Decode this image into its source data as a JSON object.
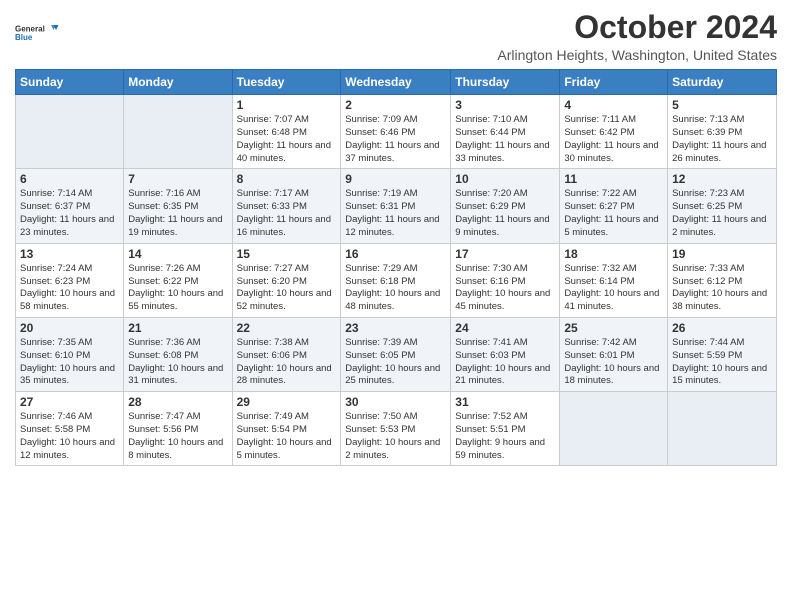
{
  "header": {
    "logo_general": "General",
    "logo_blue": "Blue",
    "month_title": "October 2024",
    "location": "Arlington Heights, Washington, United States"
  },
  "columns": [
    "Sunday",
    "Monday",
    "Tuesday",
    "Wednesday",
    "Thursday",
    "Friday",
    "Saturday"
  ],
  "weeks": [
    [
      {
        "day": "",
        "sunrise": "",
        "sunset": "",
        "daylight": ""
      },
      {
        "day": "",
        "sunrise": "",
        "sunset": "",
        "daylight": ""
      },
      {
        "day": "1",
        "sunrise": "Sunrise: 7:07 AM",
        "sunset": "Sunset: 6:48 PM",
        "daylight": "Daylight: 11 hours and 40 minutes."
      },
      {
        "day": "2",
        "sunrise": "Sunrise: 7:09 AM",
        "sunset": "Sunset: 6:46 PM",
        "daylight": "Daylight: 11 hours and 37 minutes."
      },
      {
        "day": "3",
        "sunrise": "Sunrise: 7:10 AM",
        "sunset": "Sunset: 6:44 PM",
        "daylight": "Daylight: 11 hours and 33 minutes."
      },
      {
        "day": "4",
        "sunrise": "Sunrise: 7:11 AM",
        "sunset": "Sunset: 6:42 PM",
        "daylight": "Daylight: 11 hours and 30 minutes."
      },
      {
        "day": "5",
        "sunrise": "Sunrise: 7:13 AM",
        "sunset": "Sunset: 6:39 PM",
        "daylight": "Daylight: 11 hours and 26 minutes."
      }
    ],
    [
      {
        "day": "6",
        "sunrise": "Sunrise: 7:14 AM",
        "sunset": "Sunset: 6:37 PM",
        "daylight": "Daylight: 11 hours and 23 minutes."
      },
      {
        "day": "7",
        "sunrise": "Sunrise: 7:16 AM",
        "sunset": "Sunset: 6:35 PM",
        "daylight": "Daylight: 11 hours and 19 minutes."
      },
      {
        "day": "8",
        "sunrise": "Sunrise: 7:17 AM",
        "sunset": "Sunset: 6:33 PM",
        "daylight": "Daylight: 11 hours and 16 minutes."
      },
      {
        "day": "9",
        "sunrise": "Sunrise: 7:19 AM",
        "sunset": "Sunset: 6:31 PM",
        "daylight": "Daylight: 11 hours and 12 minutes."
      },
      {
        "day": "10",
        "sunrise": "Sunrise: 7:20 AM",
        "sunset": "Sunset: 6:29 PM",
        "daylight": "Daylight: 11 hours and 9 minutes."
      },
      {
        "day": "11",
        "sunrise": "Sunrise: 7:22 AM",
        "sunset": "Sunset: 6:27 PM",
        "daylight": "Daylight: 11 hours and 5 minutes."
      },
      {
        "day": "12",
        "sunrise": "Sunrise: 7:23 AM",
        "sunset": "Sunset: 6:25 PM",
        "daylight": "Daylight: 11 hours and 2 minutes."
      }
    ],
    [
      {
        "day": "13",
        "sunrise": "Sunrise: 7:24 AM",
        "sunset": "Sunset: 6:23 PM",
        "daylight": "Daylight: 10 hours and 58 minutes."
      },
      {
        "day": "14",
        "sunrise": "Sunrise: 7:26 AM",
        "sunset": "Sunset: 6:22 PM",
        "daylight": "Daylight: 10 hours and 55 minutes."
      },
      {
        "day": "15",
        "sunrise": "Sunrise: 7:27 AM",
        "sunset": "Sunset: 6:20 PM",
        "daylight": "Daylight: 10 hours and 52 minutes."
      },
      {
        "day": "16",
        "sunrise": "Sunrise: 7:29 AM",
        "sunset": "Sunset: 6:18 PM",
        "daylight": "Daylight: 10 hours and 48 minutes."
      },
      {
        "day": "17",
        "sunrise": "Sunrise: 7:30 AM",
        "sunset": "Sunset: 6:16 PM",
        "daylight": "Daylight: 10 hours and 45 minutes."
      },
      {
        "day": "18",
        "sunrise": "Sunrise: 7:32 AM",
        "sunset": "Sunset: 6:14 PM",
        "daylight": "Daylight: 10 hours and 41 minutes."
      },
      {
        "day": "19",
        "sunrise": "Sunrise: 7:33 AM",
        "sunset": "Sunset: 6:12 PM",
        "daylight": "Daylight: 10 hours and 38 minutes."
      }
    ],
    [
      {
        "day": "20",
        "sunrise": "Sunrise: 7:35 AM",
        "sunset": "Sunset: 6:10 PM",
        "daylight": "Daylight: 10 hours and 35 minutes."
      },
      {
        "day": "21",
        "sunrise": "Sunrise: 7:36 AM",
        "sunset": "Sunset: 6:08 PM",
        "daylight": "Daylight: 10 hours and 31 minutes."
      },
      {
        "day": "22",
        "sunrise": "Sunrise: 7:38 AM",
        "sunset": "Sunset: 6:06 PM",
        "daylight": "Daylight: 10 hours and 28 minutes."
      },
      {
        "day": "23",
        "sunrise": "Sunrise: 7:39 AM",
        "sunset": "Sunset: 6:05 PM",
        "daylight": "Daylight: 10 hours and 25 minutes."
      },
      {
        "day": "24",
        "sunrise": "Sunrise: 7:41 AM",
        "sunset": "Sunset: 6:03 PM",
        "daylight": "Daylight: 10 hours and 21 minutes."
      },
      {
        "day": "25",
        "sunrise": "Sunrise: 7:42 AM",
        "sunset": "Sunset: 6:01 PM",
        "daylight": "Daylight: 10 hours and 18 minutes."
      },
      {
        "day": "26",
        "sunrise": "Sunrise: 7:44 AM",
        "sunset": "Sunset: 5:59 PM",
        "daylight": "Daylight: 10 hours and 15 minutes."
      }
    ],
    [
      {
        "day": "27",
        "sunrise": "Sunrise: 7:46 AM",
        "sunset": "Sunset: 5:58 PM",
        "daylight": "Daylight: 10 hours and 12 minutes."
      },
      {
        "day": "28",
        "sunrise": "Sunrise: 7:47 AM",
        "sunset": "Sunset: 5:56 PM",
        "daylight": "Daylight: 10 hours and 8 minutes."
      },
      {
        "day": "29",
        "sunrise": "Sunrise: 7:49 AM",
        "sunset": "Sunset: 5:54 PM",
        "daylight": "Daylight: 10 hours and 5 minutes."
      },
      {
        "day": "30",
        "sunrise": "Sunrise: 7:50 AM",
        "sunset": "Sunset: 5:53 PM",
        "daylight": "Daylight: 10 hours and 2 minutes."
      },
      {
        "day": "31",
        "sunrise": "Sunrise: 7:52 AM",
        "sunset": "Sunset: 5:51 PM",
        "daylight": "Daylight: 9 hours and 59 minutes."
      },
      {
        "day": "",
        "sunrise": "",
        "sunset": "",
        "daylight": ""
      },
      {
        "day": "",
        "sunrise": "",
        "sunset": "",
        "daylight": ""
      }
    ]
  ]
}
